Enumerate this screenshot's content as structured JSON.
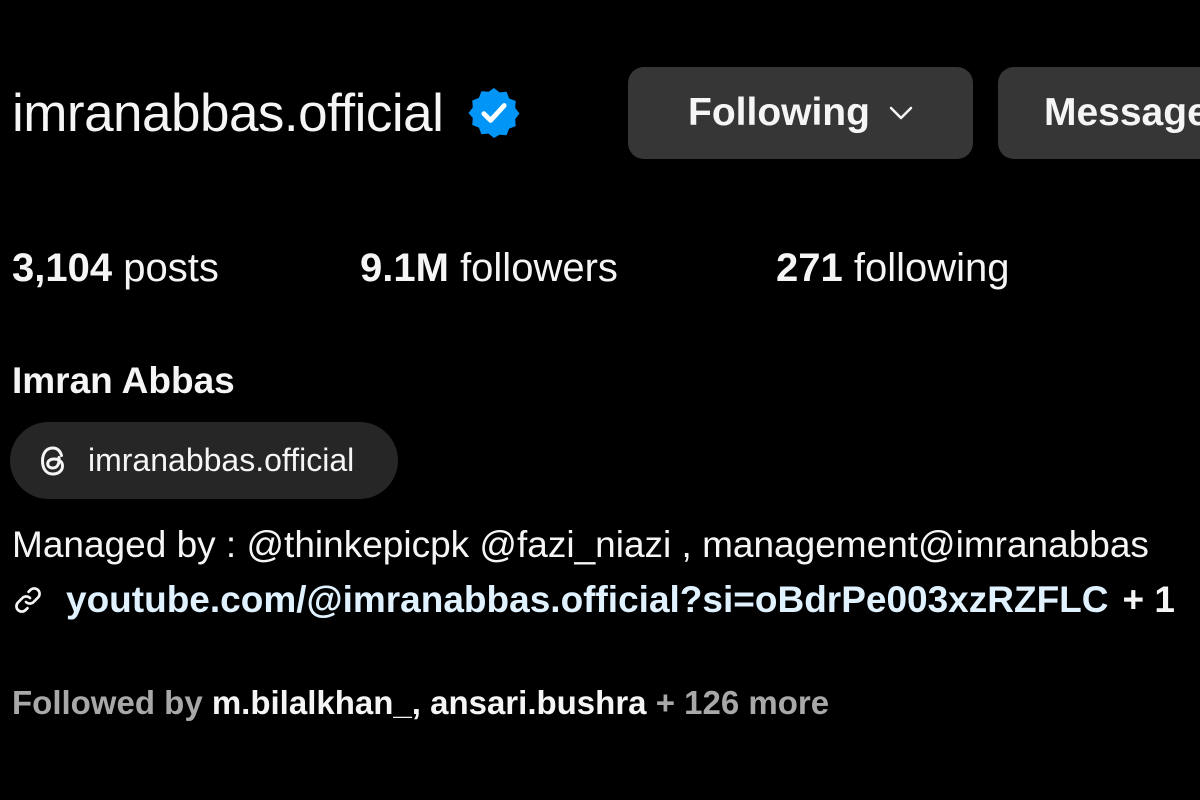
{
  "profile": {
    "username": "imranabbas.official",
    "verified_icon": "verified-badge-icon",
    "accent_color": "#0095f6",
    "buttons": {
      "following_label": "Following",
      "message_label": "Message"
    },
    "stats": {
      "posts_count": "3,104",
      "posts_label": "posts",
      "followers_count": "9.1M",
      "followers_label": "followers",
      "following_count": "271",
      "following_label": "following"
    },
    "full_name": "Imran Abbas",
    "threads": {
      "icon": "threads-icon",
      "label": "imranabbas.official"
    },
    "bio": {
      "text": "Managed by : @thinkepicpk @fazi_niazi , management@imranabbas",
      "link_icon": "link-icon",
      "link": "youtube.com/@imranabbas.official?si=oBdrPe003xzRZFLC",
      "link_extra": "+ 1"
    },
    "followed_by": {
      "prefix": "Followed by",
      "name_1": "m.bilalkhan_,",
      "name_2": "ansari.bushra",
      "more": "+ 126 more"
    }
  }
}
